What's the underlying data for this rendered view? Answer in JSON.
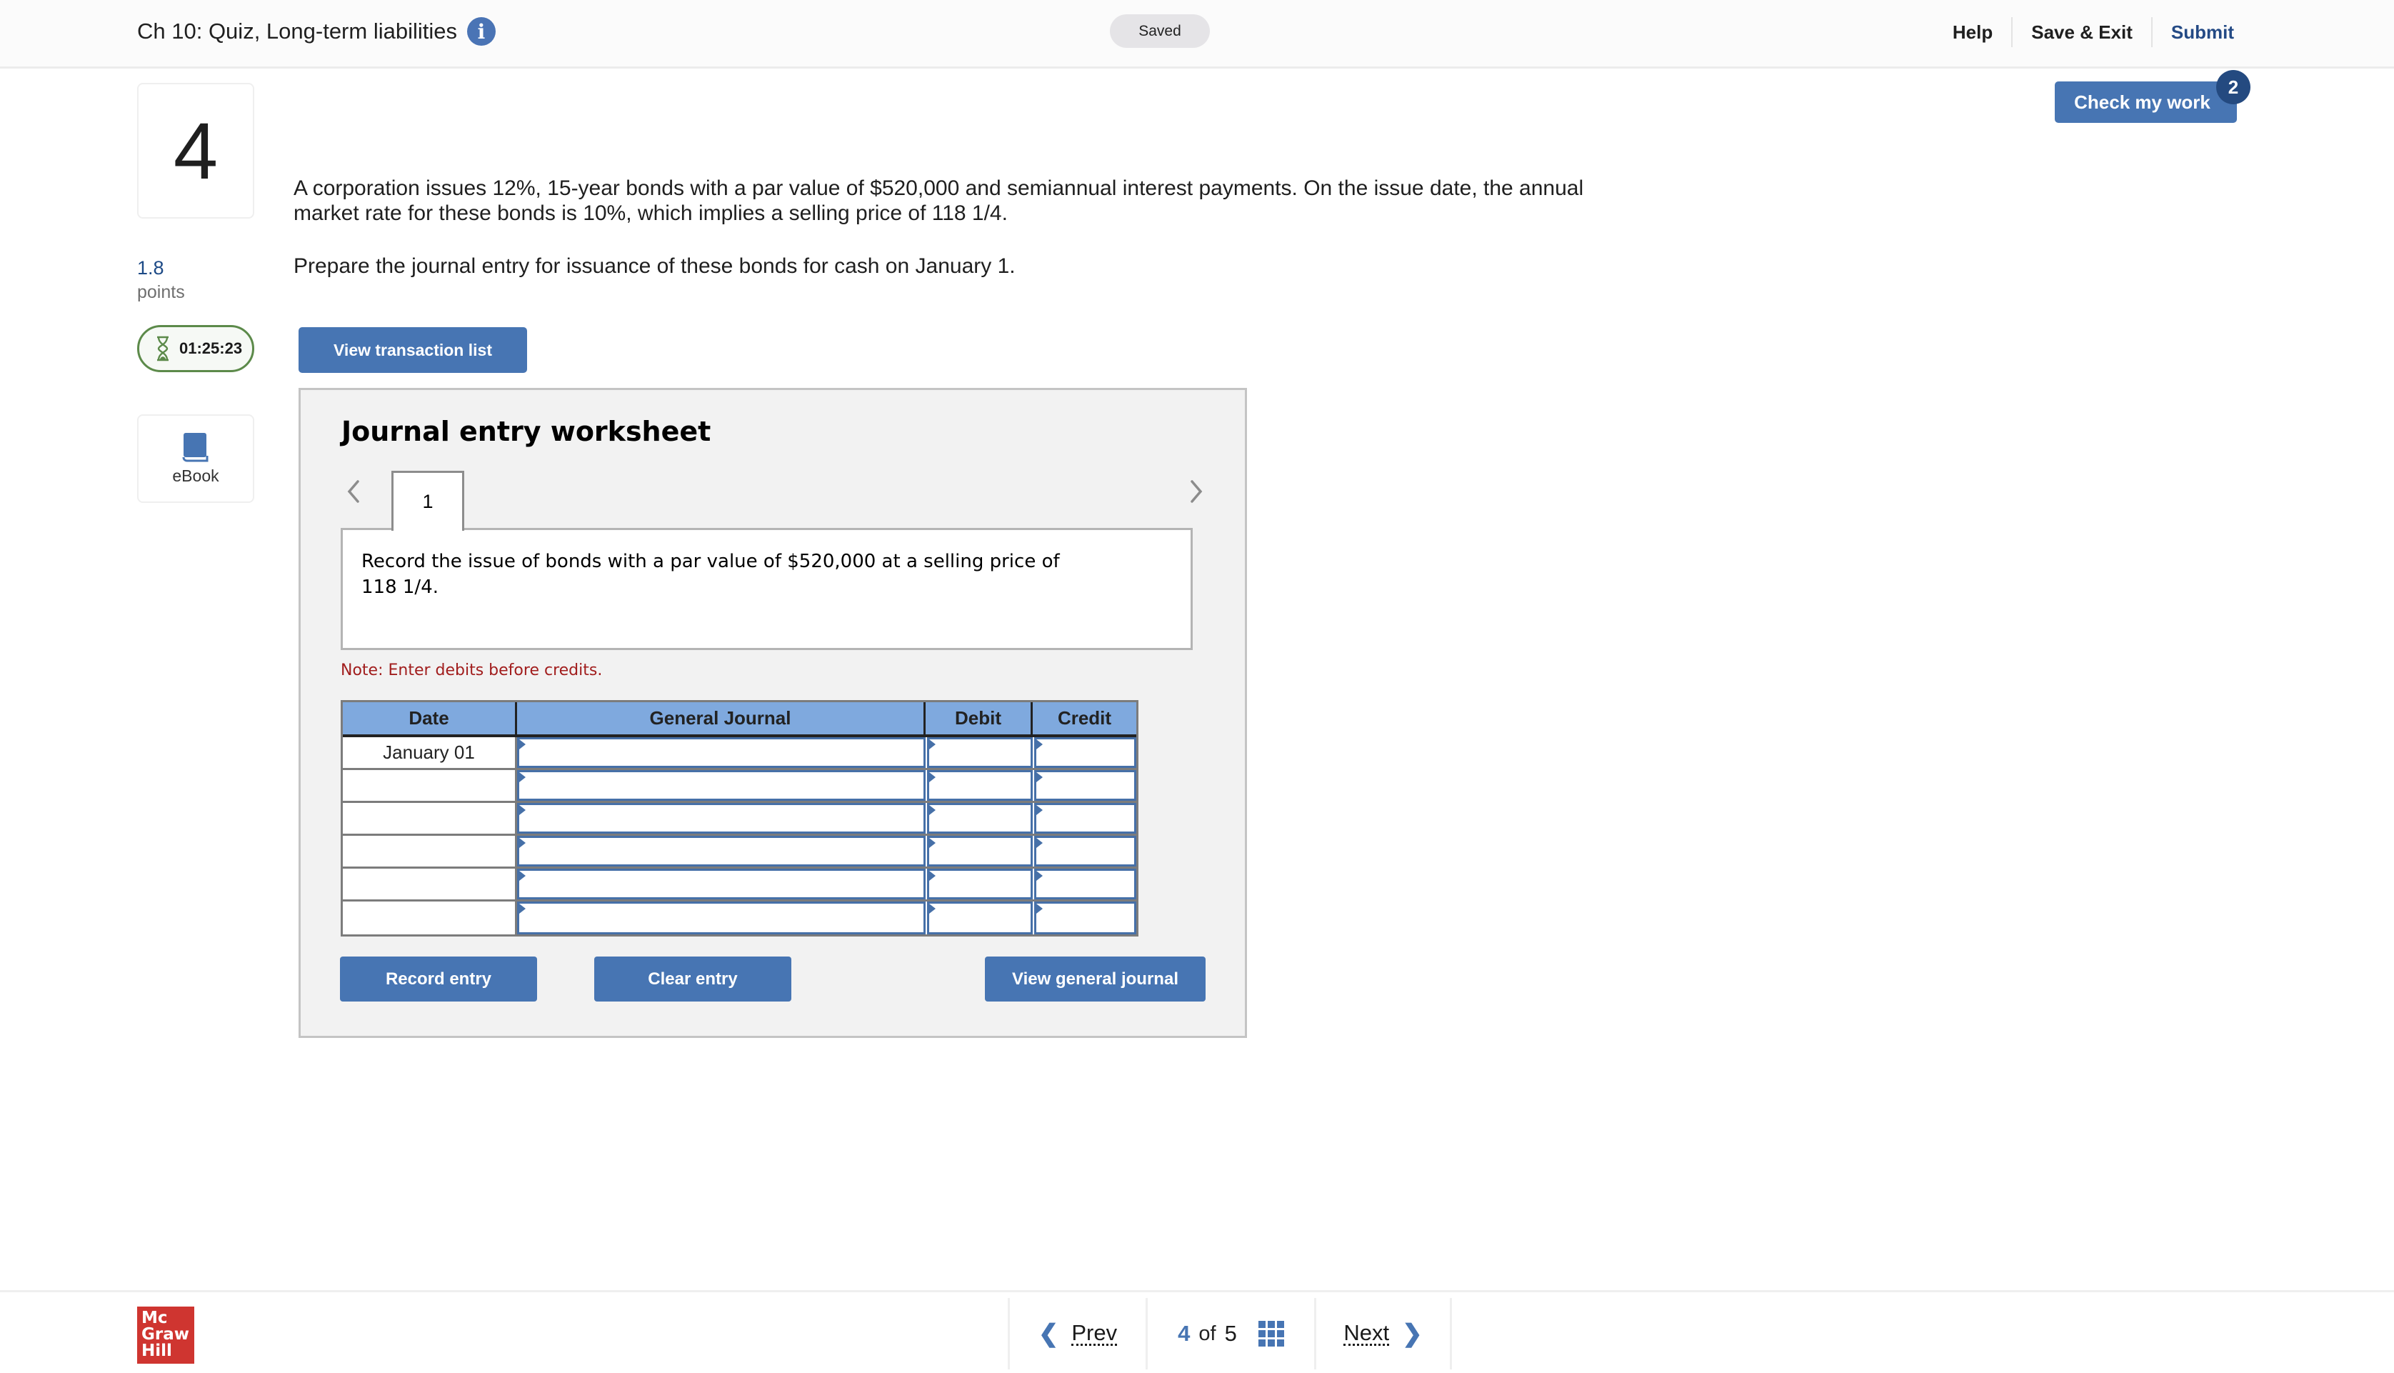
{
  "header": {
    "title": "Ch 10: Quiz, Long-term liabilities",
    "info_icon": "info-icon",
    "save_status": "Saved",
    "links": [
      "Help",
      "Save & Exit",
      "Submit"
    ],
    "check_my_work": "Check my work",
    "check_badge_count": "2"
  },
  "question": {
    "number": "4",
    "points_value": "1.8",
    "points_label": "points",
    "timer": "01:25:23",
    "ebook_label": "eBook",
    "text": "A corporation issues 12%, 15-year bonds with a par value of $520,000 and semiannual interest payments. On the issue date, the annual market rate for these bonds is 10%, which implies a selling price of 118 1/4.",
    "instruction": "Prepare the journal entry for issuance of these bonds for cash on January 1.",
    "view_transactions_label": "View transaction list"
  },
  "worksheet": {
    "title": "Journal entry worksheet",
    "active_tab": "1",
    "description": "Record the issue of bonds with a par value of $520,000 at a selling price of 118 1/4.",
    "note": "Note: Enter debits before credits.",
    "columns": [
      "Date",
      "General Journal",
      "Debit",
      "Credit"
    ],
    "rows": [
      {
        "date": "January 01",
        "account": "",
        "debit": "",
        "credit": ""
      },
      {
        "date": "",
        "account": "",
        "debit": "",
        "credit": ""
      },
      {
        "date": "",
        "account": "",
        "debit": "",
        "credit": ""
      },
      {
        "date": "",
        "account": "",
        "debit": "",
        "credit": ""
      },
      {
        "date": "",
        "account": "",
        "debit": "",
        "credit": ""
      },
      {
        "date": "",
        "account": "",
        "debit": "",
        "credit": ""
      }
    ],
    "buttons": {
      "record": "Record entry",
      "clear": "Clear entry",
      "view_general_journal": "View general journal"
    }
  },
  "footer": {
    "logo_lines": [
      "Mc",
      "Graw",
      "Hill"
    ],
    "prev_label": "Prev",
    "next_label": "Next",
    "current_page": "4",
    "of_label": "of",
    "total_pages": "5"
  },
  "colors": {
    "accent": "#4775b3",
    "badge": "#244a80",
    "table_header": "#7fa9de",
    "note_red": "#a11d1d",
    "timer_green": "#5c8a4a",
    "logo_red": "#cf3530"
  }
}
